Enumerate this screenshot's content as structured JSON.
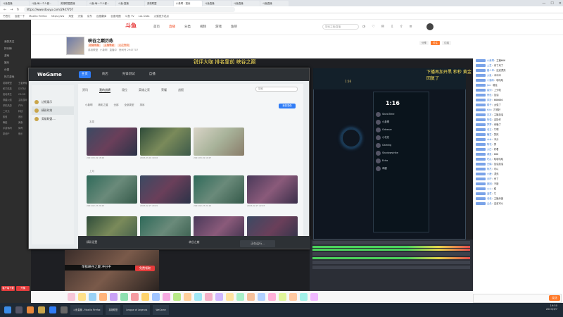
{
  "browser": {
    "tabs": [
      "斗鱼直播",
      "斗鱼-每一个人都...",
      "英雄联盟直播",
      "斗鱼-每一个人都...",
      "斗鱼-直播",
      "英雄联盟",
      "小象啊 - 搜索",
      "斗鱼直播",
      "斗鱼直播",
      "斗鱼直播"
    ],
    "url": "https://www.douyu.com/2947707",
    "bookmarks": [
      "书签栏",
      "百度一下",
      "Mozilla Firefox",
      "https://ww",
      "淘宝",
      "天猫",
      "京东",
      "百度翻译",
      "百度地图",
      "斗鱼 TV",
      "LoL Data",
      "火狐官方站点"
    ]
  },
  "leftnav": {
    "items": [
      "我的关注",
      "排行榜",
      "游戏",
      "娱乐",
      "分类",
      "热门游戏"
    ],
    "subs": [
      "英雄联盟",
      "王者荣耀",
      "和平精英",
      "DOTA2",
      "绝地求生",
      "CS:GO",
      "穿越火线",
      "主机游戏",
      "单机热游",
      "户外",
      "二次元",
      "科技",
      "颜值",
      "音乐",
      "舞蹈",
      "美食",
      "手游休闲",
      "体育",
      "原创IP",
      "鱼乐"
    ],
    "btn1": "客户端下载",
    "btn2": "开播"
  },
  "header": {
    "logo": "斗鱼",
    "nav": [
      "首页",
      "直播",
      "分类",
      "视频",
      "游戏",
      "鱼吧"
    ],
    "active_nav": 1,
    "search_placeholder": "搜索主播/直播"
  },
  "room": {
    "title": "峡谷之巅历练",
    "badges": [
      "超级明星",
      "主播等级",
      "心之所向"
    ],
    "meta": [
      "英雄联盟",
      "小象啊",
      "直播中",
      "房间号 2947707"
    ],
    "right_buttons": [
      "分享",
      "关注",
      "订阅"
    ]
  },
  "overlay_text": "锐评大咖 排名靠前 峡谷之巅",
  "wegame": {
    "logo": "WeGame",
    "tabs": [
      "主页",
      "商店",
      "先锋测试",
      "自播"
    ],
    "active_tab": 0,
    "side": [
      "边框展示",
      "精彩时刻",
      "英雄联盟-..."
    ],
    "active_side": 1,
    "subtabs": [
      "资讯",
      "我的战绩",
      "段位",
      "英雄之家",
      "荣耀",
      "战报"
    ],
    "active_subtab": 1,
    "search_placeholder": "搜索",
    "toolbar": [
      "小象啊",
      "精彩之翼",
      "全部",
      "全部类型",
      "排序"
    ],
    "blue_btn": "我的录像",
    "sec1": "本周",
    "sec2": "上月",
    "captions": [
      "2023-03-01 18:29",
      "2023-03-01 19:02",
      "2023-03-01 19:27",
      "2023-02-27 20:15",
      "2023-02-27 20:45",
      "2023-02-27 21:10",
      "2023-02-27 22:03"
    ],
    "bottom_left": "精彩设置",
    "bottom_mid": "峡谷之巅",
    "bottom_btn": "正在运行..."
  },
  "game": {
    "gold": "1:16",
    "timer": "1:16",
    "players": [
      "ShowTime",
      "小象啊",
      "Gdzzzzz",
      "小花花",
      "Gaming",
      "Shadowstrike",
      "Echo",
      "鸡腿"
    ],
    "yellow_text": "下播再加开黑 秒秒 黄金回复了"
  },
  "cam": {
    "subtitle": "单排峡谷之巅 冲分中",
    "btn": "免费领取"
  },
  "chat": {
    "lines": [
      [
        "小象啊",
        "主播666"
      ],
      [
        "土豆",
        "来了来了"
      ],
      [
        "路人甲",
        "这波漂亮"
      ],
      [
        "大鱼",
        "冲冲冲"
      ],
      [
        "小猫咪",
        "哈哈哈"
      ],
      [
        "Jax",
        "稳住"
      ],
      [
        "星河",
        "上分啦"
      ],
      [
        "夜色",
        "加油"
      ],
      [
        "风铃",
        "666666"
      ],
      [
        "橘子",
        "太强了"
      ],
      [
        "Kiki",
        "打得好"
      ],
      [
        "灰灰",
        "主播加油"
      ],
      [
        "阿强",
        "这操作"
      ],
      [
        "梦梦",
        "来晚了"
      ],
      [
        "老王",
        "牛啊"
      ],
      [
        "糖豆",
        "笑死"
      ],
      [
        "木木",
        "冲分"
      ],
      [
        "阿花",
        "秀"
      ],
      [
        "大白",
        "好看"
      ],
      [
        "咸鱼",
        "666"
      ],
      [
        "吃瓜",
        "哈哈哈哈"
      ],
      [
        "白鹤",
        "加油加油"
      ],
      [
        "阿杰",
        "可以"
      ],
      [
        "小鹿",
        "漂亮"
      ],
      [
        "青柠",
        "来了"
      ],
      [
        "团团",
        "不错"
      ],
      [
        "火火",
        "稳"
      ],
      [
        "蓝莓",
        "牛"
      ],
      [
        "老张",
        "主播厉害"
      ],
      [
        "云朵",
        "这波可以"
      ]
    ],
    "send": "发送"
  },
  "taskbar": {
    "apps": [
      "斗鱼直播 - Mozilla Firefox",
      "英雄联盟",
      "League of Legends",
      "WeGame"
    ],
    "time": "19:50",
    "date": "2023/3/7"
  }
}
